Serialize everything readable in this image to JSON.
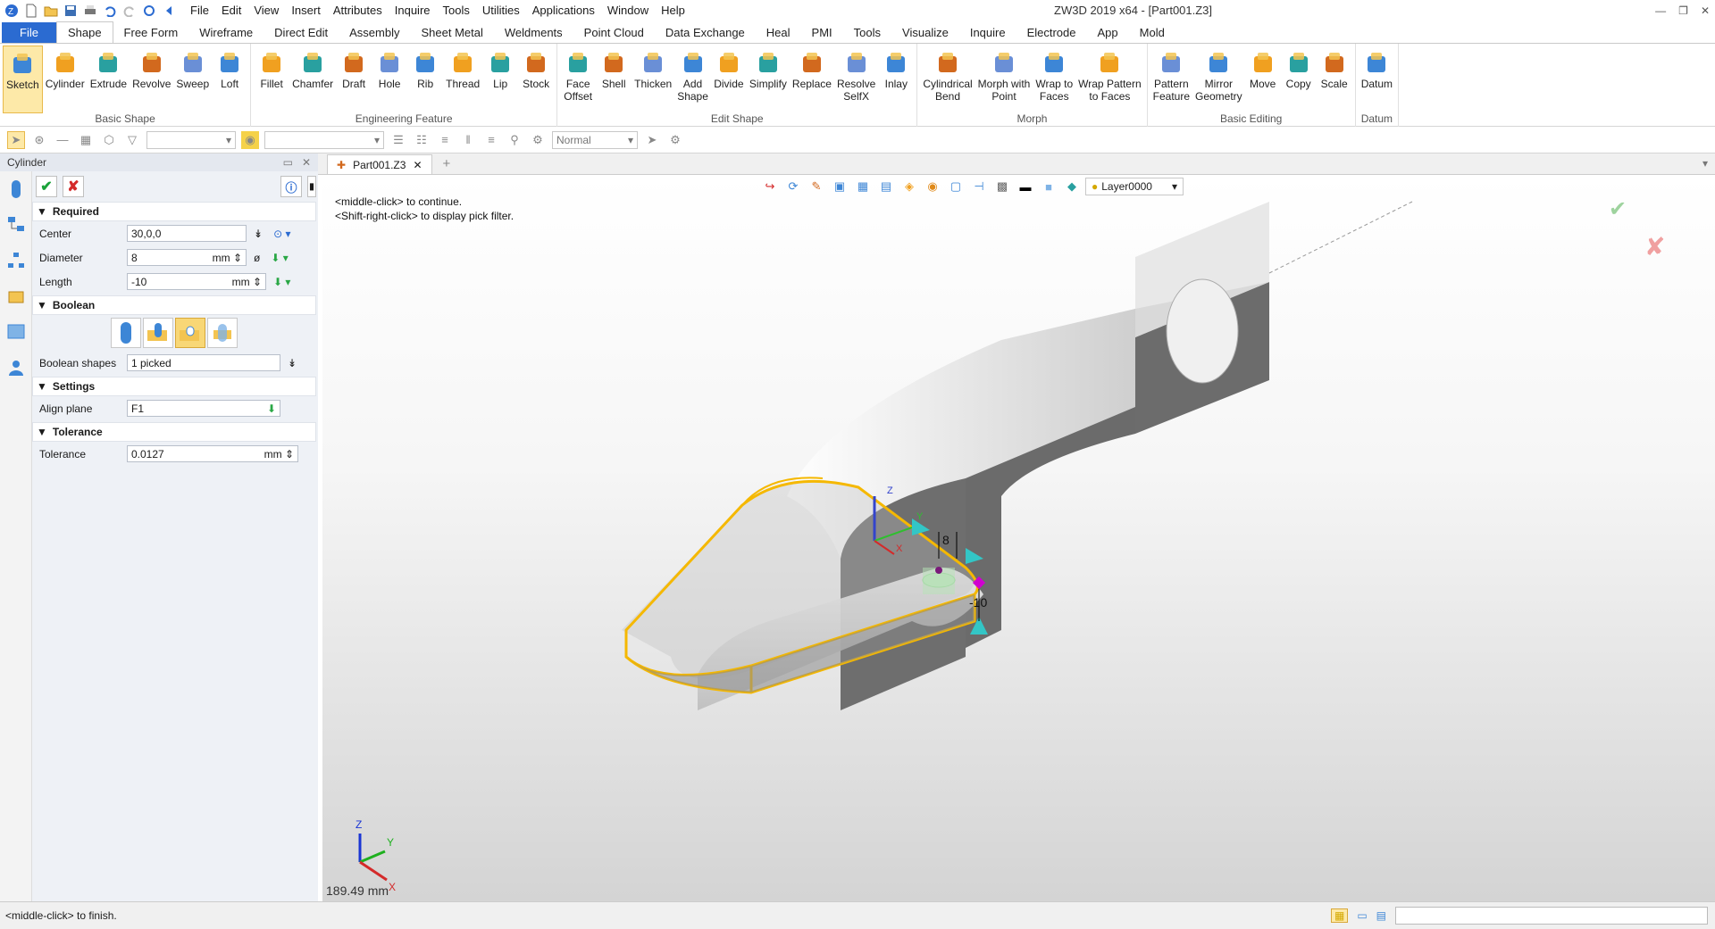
{
  "window": {
    "title": "ZW3D 2019  x64 - [Part001.Z3]"
  },
  "menu": [
    "File",
    "Edit",
    "View",
    "Insert",
    "Attributes",
    "Inquire",
    "Tools",
    "Utilities",
    "Applications",
    "Window",
    "Help"
  ],
  "ribbon_tabs": [
    "File",
    "Shape",
    "Free Form",
    "Wireframe",
    "Direct Edit",
    "Assembly",
    "Sheet Metal",
    "Weldments",
    "Point Cloud",
    "Data Exchange",
    "Heal",
    "PMI",
    "Tools",
    "Visualize",
    "Inquire",
    "Electrode",
    "App",
    "Mold"
  ],
  "active_tab": "Shape",
  "groups": [
    {
      "label": "Basic Shape",
      "items": [
        {
          "label": "Sketch",
          "icon": "sketch-icon",
          "selected": true
        },
        {
          "label": "Cylinder",
          "icon": "cylinder-icon"
        },
        {
          "label": "Extrude",
          "icon": "extrude-icon"
        },
        {
          "label": "Revolve",
          "icon": "revolve-icon"
        },
        {
          "label": "Sweep",
          "icon": "sweep-icon"
        },
        {
          "label": "Loft",
          "icon": "loft-icon"
        }
      ]
    },
    {
      "label": "Engineering Feature",
      "items": [
        {
          "label": "Fillet",
          "icon": "fillet-icon"
        },
        {
          "label": "Chamfer",
          "icon": "chamfer-icon"
        },
        {
          "label": "Draft",
          "icon": "draft-icon"
        },
        {
          "label": "Hole",
          "icon": "hole-icon"
        },
        {
          "label": "Rib",
          "icon": "rib-icon"
        },
        {
          "label": "Thread",
          "icon": "thread-icon"
        },
        {
          "label": "Lip",
          "icon": "lip-icon"
        },
        {
          "label": "Stock",
          "icon": "stock-icon"
        }
      ]
    },
    {
      "label": "Edit Shape",
      "items": [
        {
          "label": "Face\nOffset",
          "icon": "face-offset-icon"
        },
        {
          "label": "Shell",
          "icon": "shell-icon"
        },
        {
          "label": "Thicken",
          "icon": "thicken-icon"
        },
        {
          "label": "Add\nShape",
          "icon": "add-shape-icon"
        },
        {
          "label": "Divide",
          "icon": "divide-icon"
        },
        {
          "label": "Simplify",
          "icon": "simplify-icon"
        },
        {
          "label": "Replace",
          "icon": "replace-icon"
        },
        {
          "label": "Resolve\nSelfX",
          "icon": "resolve-selfx-icon"
        },
        {
          "label": "Inlay",
          "icon": "inlay-icon"
        }
      ]
    },
    {
      "label": "Morph",
      "items": [
        {
          "label": "Cylindrical\nBend",
          "icon": "cylindrical-bend-icon"
        },
        {
          "label": "Morph with\nPoint",
          "icon": "morph-point-icon"
        },
        {
          "label": "Wrap to\nFaces",
          "icon": "wrap-faces-icon"
        },
        {
          "label": "Wrap Pattern\nto Faces",
          "icon": "wrap-pattern-icon"
        }
      ]
    },
    {
      "label": "Basic Editing",
      "items": [
        {
          "label": "Pattern\nFeature",
          "icon": "pattern-feature-icon"
        },
        {
          "label": "Mirror\nGeometry",
          "icon": "mirror-geometry-icon"
        },
        {
          "label": "Move",
          "icon": "move-icon"
        },
        {
          "label": "Copy",
          "icon": "copy-icon"
        },
        {
          "label": "Scale",
          "icon": "scale-icon"
        }
      ]
    },
    {
      "label": "Datum",
      "items": [
        {
          "label": "Datum",
          "icon": "datum-icon"
        }
      ]
    }
  ],
  "toolbar2": {
    "filter_value": "Normal"
  },
  "panel": {
    "title": "Cylinder",
    "sections": {
      "required": "Required",
      "boolean": "Boolean",
      "settings": "Settings",
      "tolerance": "Tolerance"
    },
    "center": {
      "label": "Center",
      "value": "30,0,0"
    },
    "diameter": {
      "label": "Diameter",
      "value": "8",
      "unit": "mm"
    },
    "length": {
      "label": "Length",
      "value": "-10",
      "unit": "mm"
    },
    "boolean_shapes": {
      "label": "Boolean shapes",
      "value": "1 picked"
    },
    "align_plane": {
      "label": "Align plane",
      "value": "F1"
    },
    "tolerance": {
      "label": "Tolerance",
      "value": "0.0127",
      "unit": "mm"
    }
  },
  "doc_tab": "Part001.Z3",
  "viewport": {
    "prompt_line1": "<middle-click> to continue.",
    "prompt_line2": "<Shift-right-click> to display pick filter.",
    "layer": "Layer0000",
    "measure": "189.49 mm",
    "dim_diameter": "8",
    "dim_length": "-10",
    "axis_x": "X",
    "axis_y": "Y",
    "axis_z": "Z"
  },
  "status": {
    "text": "<middle-click> to finish."
  },
  "colors": {
    "accent": "#2b6bd1",
    "highlight": "#f5b800",
    "selected_tab_bg": "#fde9a8"
  }
}
